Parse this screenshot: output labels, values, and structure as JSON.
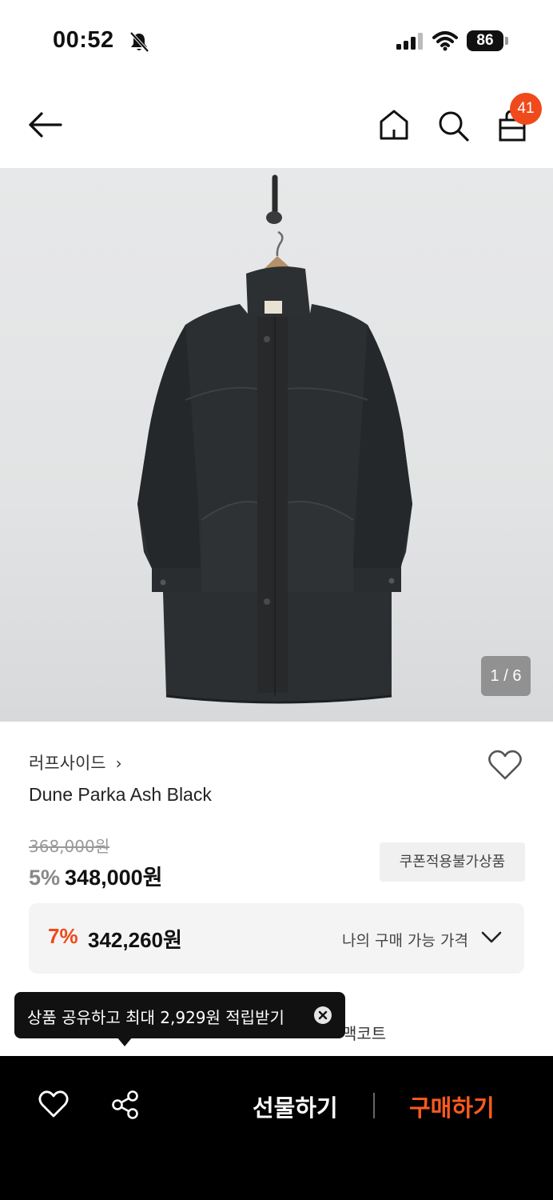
{
  "status_bar": {
    "time": "00:52",
    "battery": "86",
    "icons": [
      "bell-slash-icon",
      "signal-icon",
      "wifi-icon",
      "battery-icon"
    ]
  },
  "nav": {
    "icons": [
      "back-arrow-icon",
      "home-icon",
      "search-icon",
      "shopping-bag-icon"
    ],
    "cart_badge": "41"
  },
  "gallery": {
    "counter": "1 / 6"
  },
  "product": {
    "brand": "러프사이드",
    "brand_chevron": "›",
    "name": "Dune Parka Ash Black",
    "original_price": "368,000원",
    "discount_rate": "5%",
    "sale_price": "348,000원",
    "coupon_tag": "쿠폰적용불가상품"
  },
  "my_price": {
    "rate": "7%",
    "amount": "342,260원",
    "label": "나의 구매 가능 가격"
  },
  "behind_tooltip_text": "맥코트",
  "tooltip": {
    "text": "상품 공유하고 최대 2,929원 적립받기"
  },
  "bottom_bar": {
    "gift_label": "선물하기",
    "buy_label": "구매하기",
    "icons": [
      "heart-icon",
      "share-icon"
    ]
  },
  "colors": {
    "accent": "#f04a1c",
    "buy": "#ff5a1f",
    "bar": "#000000"
  }
}
